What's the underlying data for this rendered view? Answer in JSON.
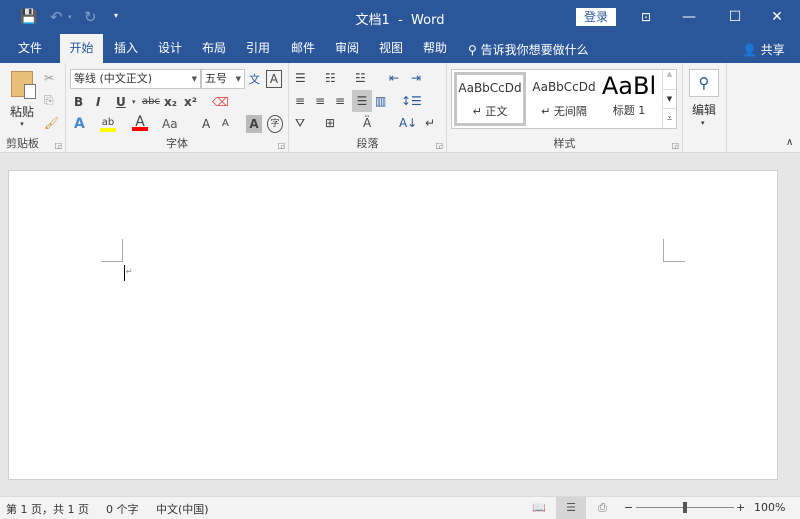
{
  "title": "文档1  -  Word",
  "login": "登录",
  "tabs": [
    "文件",
    "开始",
    "插入",
    "设计",
    "布局",
    "引用",
    "邮件",
    "审阅",
    "视图",
    "帮助"
  ],
  "tell_me": "告诉我你想要做什么",
  "share": "共享",
  "clipboard": {
    "paste": "粘贴",
    "label": "剪贴板"
  },
  "font": {
    "name": "等线 (中文正文)",
    "size": "五号",
    "label": "字体",
    "bold": "B",
    "italic": "I",
    "underline": "U",
    "strike": "abc",
    "sub": "x₂",
    "sup": "x²",
    "grow": "A",
    "shrink": "A",
    "case": "Aa",
    "color_a": "A",
    "phonetic": "文",
    "border_a": "A",
    "shade_a": "A",
    "enclose": "字"
  },
  "paragraph": {
    "label": "段落"
  },
  "styles": {
    "label": "样式",
    "items": [
      {
        "preview": "AaBbCcDd",
        "name": "↵ 正文"
      },
      {
        "preview": "AaBbCcDd",
        "name": "↵ 无间隔"
      },
      {
        "preview": "AaBl",
        "name": "标题 1"
      }
    ]
  },
  "editing": {
    "label": "编辑"
  },
  "status": {
    "page": "第 1 页，共 1 页",
    "words": "0 个字",
    "lang": "中文(中国)",
    "zoom": "100%",
    "zoom_level": 100
  },
  "colors": {
    "brand": "#2b579a",
    "highlight": "#ffff00",
    "font_color": "#ff0000"
  }
}
